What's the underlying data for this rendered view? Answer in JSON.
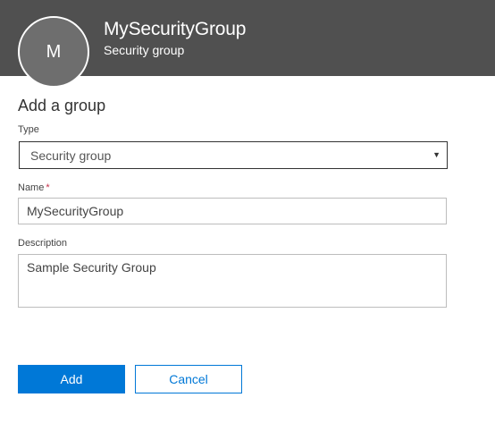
{
  "header": {
    "avatar_initial": "M",
    "title": "MySecurityGroup",
    "subtitle": "Security group"
  },
  "form": {
    "title": "Add a group",
    "type": {
      "label": "Type",
      "selected": "Security group",
      "arrow_icon": "caret-down-icon"
    },
    "name": {
      "label": "Name",
      "required_marker": "*",
      "value": "MySecurityGroup"
    },
    "description": {
      "label": "Description",
      "value": "Sample Security Group"
    }
  },
  "actions": {
    "add_label": "Add",
    "cancel_label": "Cancel"
  },
  "colors": {
    "header_bg": "#505050",
    "accent": "#0078d7",
    "required": "#c4314b"
  }
}
